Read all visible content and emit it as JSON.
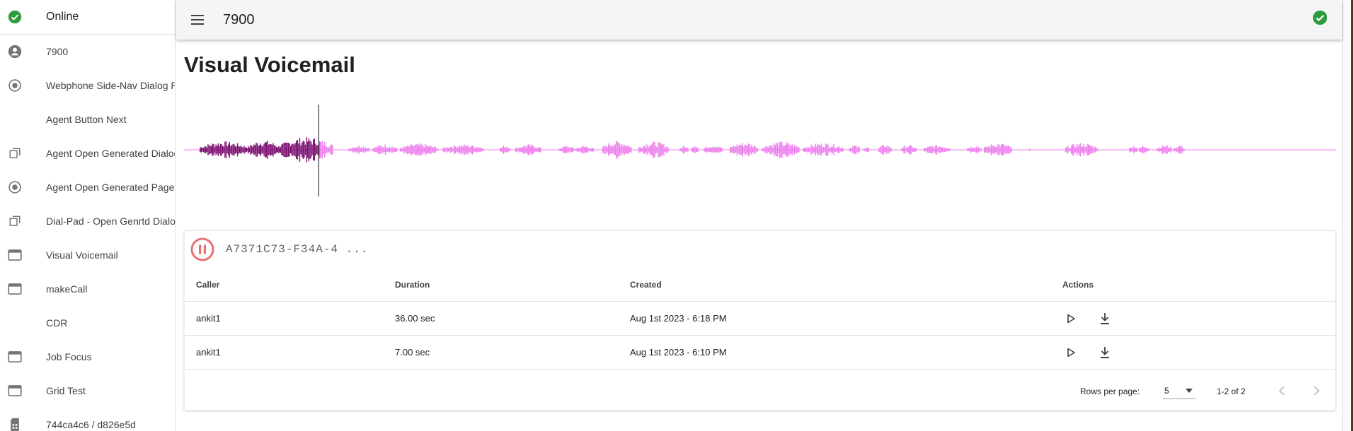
{
  "sidebar": {
    "status_label": "Online",
    "items": [
      {
        "label": "7900",
        "icon": "account-circle-icon"
      },
      {
        "label": "Webphone Side-Nav Dialog Page",
        "icon": "radio-circle-icon"
      },
      {
        "label": "Agent Button Next",
        "icon": ""
      },
      {
        "label": "Agent Open Generated Dialog",
        "icon": "filter-none-icon"
      },
      {
        "label": "Agent Open Generated Page-Nav",
        "icon": "radio-circle-icon"
      },
      {
        "label": "Dial-Pad - Open Genrtd Dialog",
        "icon": "filter-none-icon"
      },
      {
        "label": "Visual Voicemail",
        "icon": "web-asset-icon"
      },
      {
        "label": "makeCall",
        "icon": "web-asset-icon"
      },
      {
        "label": "CDR",
        "icon": ""
      },
      {
        "label": "Job Focus",
        "icon": "web-asset-icon"
      },
      {
        "label": "Grid Test",
        "icon": "web-asset-icon"
      },
      {
        "label": "744ca4c6 / d826e5d",
        "icon": "sim-card-icon"
      }
    ]
  },
  "topbar": {
    "title": "7900",
    "menu_icon": "menu-icon",
    "status_icon": "check-circle-icon"
  },
  "main": {
    "title": "Visual Voicemail",
    "player": {
      "file_name": "A7371C73-F34A-4 ...",
      "progress": 0.117,
      "played_color": "#7b1071",
      "unplayed_color": "#ee82ee"
    },
    "table": {
      "columns": [
        "Caller",
        "Duration",
        "Created",
        "Actions"
      ],
      "rows": [
        {
          "caller": "ankit1",
          "duration": "36.00 sec",
          "created": "Aug 1st 2023 - 6:18 PM"
        },
        {
          "caller": "ankit1",
          "duration": "7.00 sec",
          "created": "Aug 1st 2023 - 6:10 PM"
        }
      ]
    },
    "pagination": {
      "rows_per_page_label": "Rows per page:",
      "rows_per_page": "5",
      "range": "1-2 of 2"
    }
  },
  "colors": {
    "status_green": "#2e9c3a",
    "pause_red": "#e57373"
  }
}
